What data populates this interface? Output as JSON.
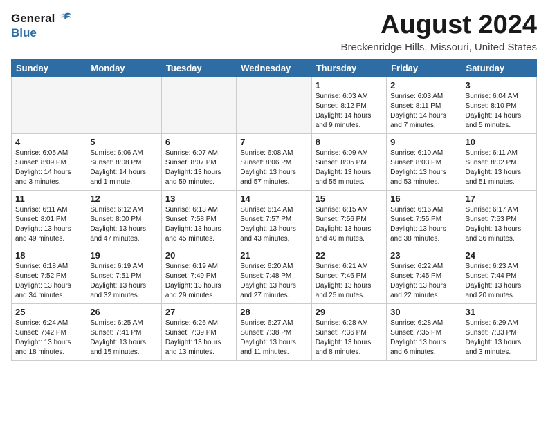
{
  "header": {
    "logo_general": "General",
    "logo_blue": "Blue",
    "month_year": "August 2024",
    "location": "Breckenridge Hills, Missouri, United States"
  },
  "days_of_week": [
    "Sunday",
    "Monday",
    "Tuesday",
    "Wednesday",
    "Thursday",
    "Friday",
    "Saturday"
  ],
  "weeks": [
    [
      {
        "day": "",
        "info": ""
      },
      {
        "day": "",
        "info": ""
      },
      {
        "day": "",
        "info": ""
      },
      {
        "day": "",
        "info": ""
      },
      {
        "day": "1",
        "info": "Sunrise: 6:03 AM\nSunset: 8:12 PM\nDaylight: 14 hours\nand 9 minutes."
      },
      {
        "day": "2",
        "info": "Sunrise: 6:03 AM\nSunset: 8:11 PM\nDaylight: 14 hours\nand 7 minutes."
      },
      {
        "day": "3",
        "info": "Sunrise: 6:04 AM\nSunset: 8:10 PM\nDaylight: 14 hours\nand 5 minutes."
      }
    ],
    [
      {
        "day": "4",
        "info": "Sunrise: 6:05 AM\nSunset: 8:09 PM\nDaylight: 14 hours\nand 3 minutes."
      },
      {
        "day": "5",
        "info": "Sunrise: 6:06 AM\nSunset: 8:08 PM\nDaylight: 14 hours\nand 1 minute."
      },
      {
        "day": "6",
        "info": "Sunrise: 6:07 AM\nSunset: 8:07 PM\nDaylight: 13 hours\nand 59 minutes."
      },
      {
        "day": "7",
        "info": "Sunrise: 6:08 AM\nSunset: 8:06 PM\nDaylight: 13 hours\nand 57 minutes."
      },
      {
        "day": "8",
        "info": "Sunrise: 6:09 AM\nSunset: 8:05 PM\nDaylight: 13 hours\nand 55 minutes."
      },
      {
        "day": "9",
        "info": "Sunrise: 6:10 AM\nSunset: 8:03 PM\nDaylight: 13 hours\nand 53 minutes."
      },
      {
        "day": "10",
        "info": "Sunrise: 6:11 AM\nSunset: 8:02 PM\nDaylight: 13 hours\nand 51 minutes."
      }
    ],
    [
      {
        "day": "11",
        "info": "Sunrise: 6:11 AM\nSunset: 8:01 PM\nDaylight: 13 hours\nand 49 minutes."
      },
      {
        "day": "12",
        "info": "Sunrise: 6:12 AM\nSunset: 8:00 PM\nDaylight: 13 hours\nand 47 minutes."
      },
      {
        "day": "13",
        "info": "Sunrise: 6:13 AM\nSunset: 7:58 PM\nDaylight: 13 hours\nand 45 minutes."
      },
      {
        "day": "14",
        "info": "Sunrise: 6:14 AM\nSunset: 7:57 PM\nDaylight: 13 hours\nand 43 minutes."
      },
      {
        "day": "15",
        "info": "Sunrise: 6:15 AM\nSunset: 7:56 PM\nDaylight: 13 hours\nand 40 minutes."
      },
      {
        "day": "16",
        "info": "Sunrise: 6:16 AM\nSunset: 7:55 PM\nDaylight: 13 hours\nand 38 minutes."
      },
      {
        "day": "17",
        "info": "Sunrise: 6:17 AM\nSunset: 7:53 PM\nDaylight: 13 hours\nand 36 minutes."
      }
    ],
    [
      {
        "day": "18",
        "info": "Sunrise: 6:18 AM\nSunset: 7:52 PM\nDaylight: 13 hours\nand 34 minutes."
      },
      {
        "day": "19",
        "info": "Sunrise: 6:19 AM\nSunset: 7:51 PM\nDaylight: 13 hours\nand 32 minutes."
      },
      {
        "day": "20",
        "info": "Sunrise: 6:19 AM\nSunset: 7:49 PM\nDaylight: 13 hours\nand 29 minutes."
      },
      {
        "day": "21",
        "info": "Sunrise: 6:20 AM\nSunset: 7:48 PM\nDaylight: 13 hours\nand 27 minutes."
      },
      {
        "day": "22",
        "info": "Sunrise: 6:21 AM\nSunset: 7:46 PM\nDaylight: 13 hours\nand 25 minutes."
      },
      {
        "day": "23",
        "info": "Sunrise: 6:22 AM\nSunset: 7:45 PM\nDaylight: 13 hours\nand 22 minutes."
      },
      {
        "day": "24",
        "info": "Sunrise: 6:23 AM\nSunset: 7:44 PM\nDaylight: 13 hours\nand 20 minutes."
      }
    ],
    [
      {
        "day": "25",
        "info": "Sunrise: 6:24 AM\nSunset: 7:42 PM\nDaylight: 13 hours\nand 18 minutes."
      },
      {
        "day": "26",
        "info": "Sunrise: 6:25 AM\nSunset: 7:41 PM\nDaylight: 13 hours\nand 15 minutes."
      },
      {
        "day": "27",
        "info": "Sunrise: 6:26 AM\nSunset: 7:39 PM\nDaylight: 13 hours\nand 13 minutes."
      },
      {
        "day": "28",
        "info": "Sunrise: 6:27 AM\nSunset: 7:38 PM\nDaylight: 13 hours\nand 11 minutes."
      },
      {
        "day": "29",
        "info": "Sunrise: 6:28 AM\nSunset: 7:36 PM\nDaylight: 13 hours\nand 8 minutes."
      },
      {
        "day": "30",
        "info": "Sunrise: 6:28 AM\nSunset: 7:35 PM\nDaylight: 13 hours\nand 6 minutes."
      },
      {
        "day": "31",
        "info": "Sunrise: 6:29 AM\nSunset: 7:33 PM\nDaylight: 13 hours\nand 3 minutes."
      }
    ]
  ]
}
